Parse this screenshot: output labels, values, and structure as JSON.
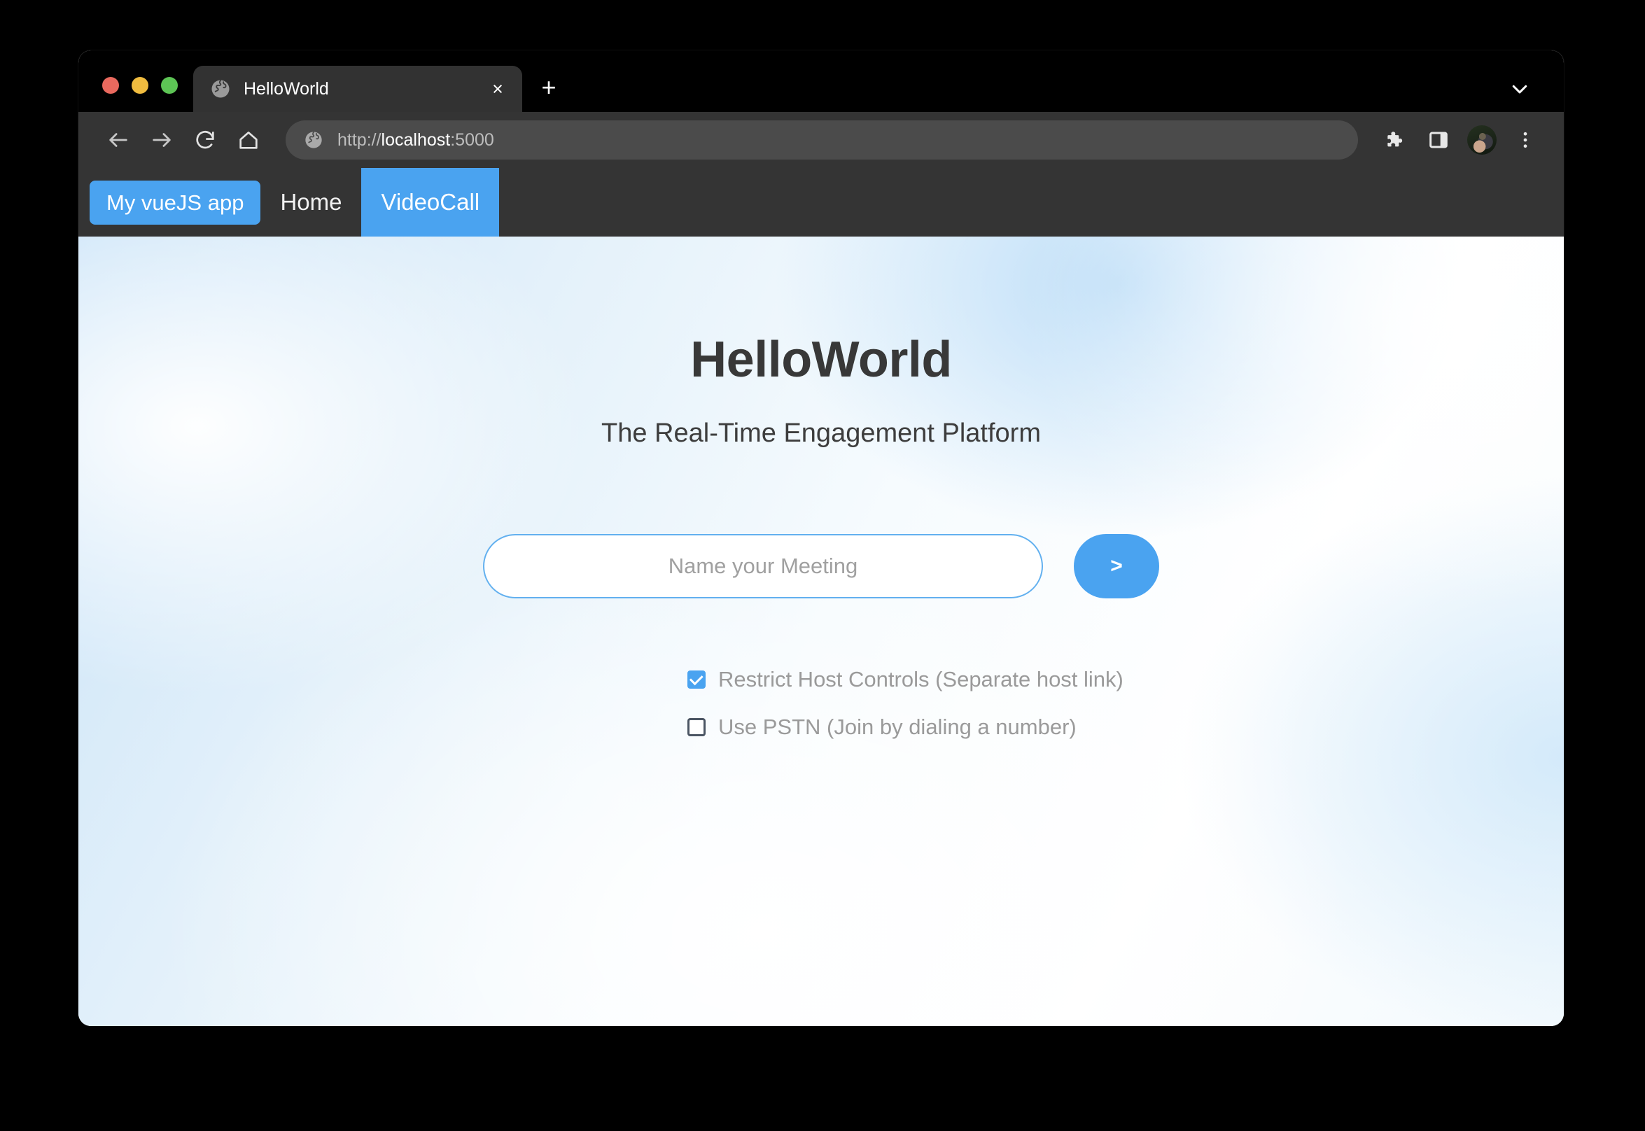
{
  "window": {
    "traffic_lights": [
      {
        "name": "close",
        "color": "#e9695e"
      },
      {
        "name": "minimize",
        "color": "#f0bc3f"
      },
      {
        "name": "maximize",
        "color": "#5dc455"
      }
    ],
    "tab_list_chevron_icon": "chevron-down-icon"
  },
  "browser": {
    "tab": {
      "title": "HelloWorld",
      "favicon_icon": "globe-icon",
      "close_label": "×"
    },
    "new_tab_label": "+",
    "toolbar": {
      "back_icon": "arrow-left-icon",
      "forward_icon": "arrow-right-icon",
      "reload_icon": "reload-icon",
      "home_icon": "home-icon",
      "extensions_icon": "puzzle-icon",
      "side_panel_icon": "side-panel-icon",
      "profile_icon": "avatar-icon",
      "menu_icon": "three-dots-icon"
    },
    "omnibox": {
      "site_icon": "globe-icon",
      "url_scheme": "http://",
      "url_host": "localhost",
      "url_port": ":5000",
      "url_full": "http://localhost:5000"
    }
  },
  "app": {
    "nav": {
      "brand": "My vueJS app",
      "links": [
        {
          "label": "Home",
          "active": false
        },
        {
          "label": "VideoCall",
          "active": true
        }
      ]
    },
    "hero": {
      "title": "HelloWorld",
      "subtitle": "The Real-Time Engagement Platform"
    },
    "form": {
      "meeting_name_value": "",
      "meeting_name_placeholder": "Name your Meeting",
      "submit_label": ">"
    },
    "options": [
      {
        "label": "Restrict Host Controls (Separate host link)",
        "checked": true
      },
      {
        "label": "Use PSTN (Join by dialing a number)",
        "checked": false
      }
    ]
  },
  "colors": {
    "accent": "#4aa3f0",
    "nav_bar": "#343434",
    "input_border": "#62b0ef",
    "heading": "#383838",
    "muted_text": "#9a9a9a"
  }
}
